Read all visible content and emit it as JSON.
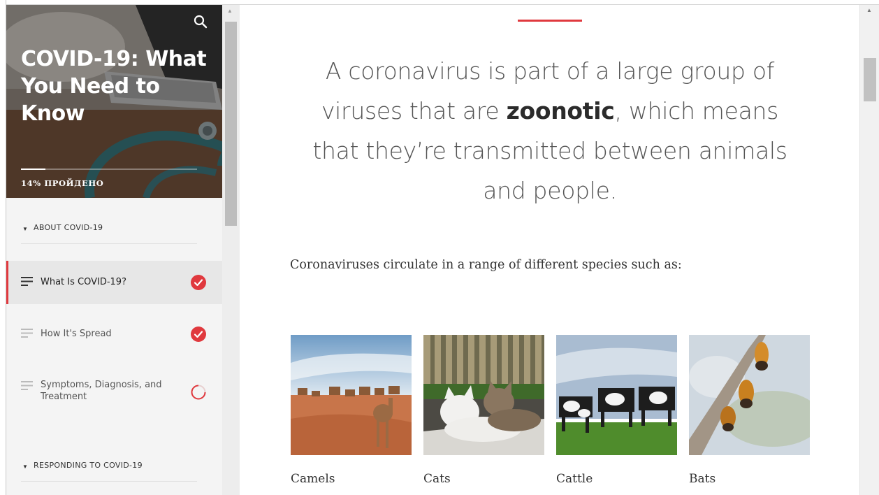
{
  "course": {
    "title": "COVID-19: What You Need to Know",
    "progress_percent": 14,
    "progress_label": "14% ПРОЙДЕНО"
  },
  "sidebar": {
    "sections": [
      {
        "label": "ABOUT COVID-19",
        "lessons": [
          {
            "title": "What Is COVID-19?",
            "status": "complete",
            "active": true
          },
          {
            "title": "How It's Spread",
            "status": "complete",
            "active": false
          },
          {
            "title": "Symptoms, Diagnosis, and Treatment",
            "status": "in-progress",
            "active": false
          }
        ]
      },
      {
        "label": "RESPONDING TO COVID-19",
        "lessons": []
      }
    ]
  },
  "content": {
    "statement": {
      "before": "A coronavirus is part of a large group of viruses that are ",
      "emphasis": "zoonotic",
      "after": ", which means that they’re transmitted between animals and people."
    },
    "lead": "Coronaviruses circulate in a range of different species such as:",
    "gallery": [
      {
        "caption": "Camels"
      },
      {
        "caption": "Cats"
      },
      {
        "caption": "Cattle"
      },
      {
        "caption": "Bats"
      }
    ]
  },
  "icons": {
    "search": "search-icon",
    "complete": "check-circle-icon",
    "in_progress": "progress-ring-icon",
    "lesson": "lesson-lines-icon",
    "caret": "caret-down-icon"
  },
  "colors": {
    "accent": "#e0393e",
    "sidebar_bg": "#f4f4f4",
    "active_lesson_bg": "#e7e7e7"
  }
}
